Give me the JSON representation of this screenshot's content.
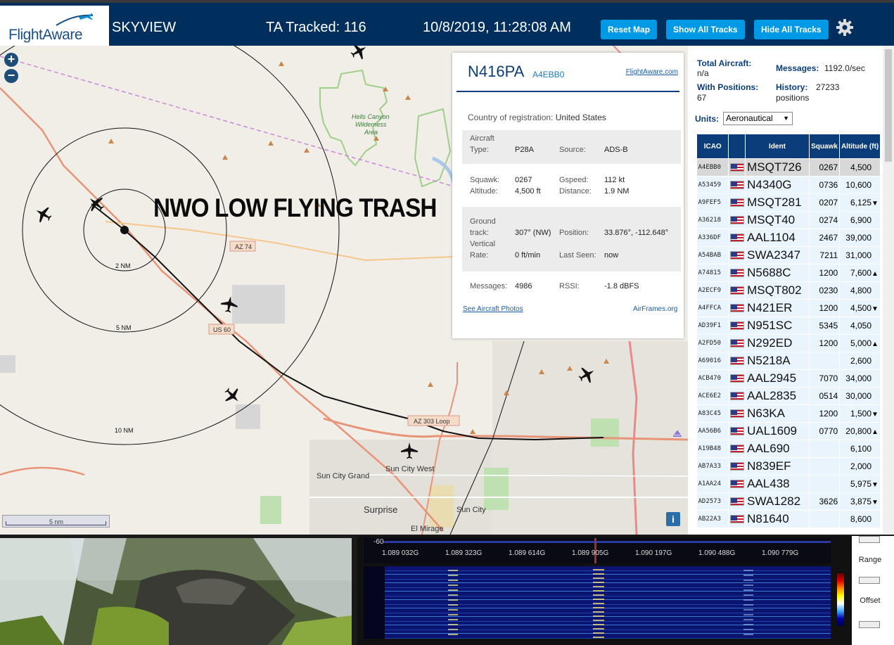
{
  "header": {
    "logo_text": "FlightAware",
    "app_name": "SKYVIEW",
    "tracked": "TA Tracked: 116",
    "datetime": "10/8/2019, 11:28:08 AM",
    "btn_reset": "Reset Map",
    "btn_show": "Show All Tracks",
    "btn_hide": "Hide All Tracks"
  },
  "map": {
    "watermark": "NWO LOW FLYING TRASH",
    "ring_labels": [
      "2 NM",
      "5 NM",
      "10 NM"
    ],
    "place_labels": [
      "Hells Canyon",
      "Wilderness",
      "Area",
      "Sun City West",
      "Sun City Grand",
      "Surprise",
      "Sun City",
      "El Mirage"
    ],
    "road_labels": [
      "AZ 74",
      "US 60",
      "AZ 303 Loop"
    ],
    "scale": "5 nm",
    "info": "i"
  },
  "popup": {
    "ident": "N416PA",
    "hex": "A4EBB0",
    "link": "FlightAware.com",
    "country_label": "Country of registration:",
    "country": "United States",
    "aircraft_type_label_1": "Aircraft",
    "aircraft_type_label_2": "Type:",
    "aircraft_type": "P28A",
    "source_label": "Source:",
    "source": "ADS-B",
    "squawk_label": "Squawk:",
    "squawk": "0267",
    "gspeed_label": "Gspeed:",
    "gspeed": "112 kt",
    "altitude_label": "Altitude:",
    "altitude": "4,500 ft",
    "distance_label": "Distance:",
    "distance": "1.9 NM",
    "ground_label_1": "Ground",
    "ground_label_2": "track:",
    "ground_track": "307° (NW)",
    "position_label": "Position:",
    "position": "33.876°, -112.648°",
    "vertical_label_1": "Vertical",
    "vertical_label_2": "Rate:",
    "vertical_rate": "0 ft/min",
    "last_seen_label": "Last Seen:",
    "last_seen": "now",
    "messages_label": "Messages:",
    "messages": "4986",
    "rssi_label": "RSSI:",
    "rssi": "-1.8 dBFS",
    "photos_link": "See Aircraft Photos",
    "airframes_link": "AirFrames.org"
  },
  "sidebar": {
    "total_label": "Total Aircraft:",
    "total_value": "n/a",
    "messages_label": "Messages:",
    "messages_value": "1192.0/sec",
    "with_pos_label": "With Positions:",
    "with_pos_value": "67",
    "history_label": "History:",
    "history_value": "27233",
    "history_unit": "positions",
    "units_label": "Units:",
    "units_value": "Aeronautical",
    "columns": [
      "ICAO",
      "",
      "Ident",
      "Squawk",
      "Altitude (ft)"
    ],
    "rows": [
      {
        "icao": "A4EBB0",
        "ident": "MSQT726",
        "squawk": "0267",
        "alt": "4,500",
        "trend": ""
      },
      {
        "icao": "A53459",
        "ident": "N4340G",
        "squawk": "0736",
        "alt": "10,600",
        "trend": ""
      },
      {
        "icao": "A9FEF5",
        "ident": "MSQT281",
        "squawk": "0207",
        "alt": "6,125",
        "trend": "▼"
      },
      {
        "icao": "A36218",
        "ident": "MSQT40",
        "squawk": "0274",
        "alt": "6,900",
        "trend": ""
      },
      {
        "icao": "A336DF",
        "ident": "AAL1104",
        "squawk": "2467",
        "alt": "39,000",
        "trend": ""
      },
      {
        "icao": "A54BAB",
        "ident": "SWA2347",
        "squawk": "7211",
        "alt": "31,000",
        "trend": ""
      },
      {
        "icao": "A74815",
        "ident": "N5688C",
        "squawk": "1200",
        "alt": "7,600",
        "trend": "▲"
      },
      {
        "icao": "A2ECF9",
        "ident": "MSQT802",
        "squawk": "0230",
        "alt": "4,800",
        "trend": ""
      },
      {
        "icao": "A4FFCA",
        "ident": "N421ER",
        "squawk": "1200",
        "alt": "4,500",
        "trend": "▼"
      },
      {
        "icao": "AD39F1",
        "ident": "N951SC",
        "squawk": "5345",
        "alt": "4,050",
        "trend": ""
      },
      {
        "icao": "A2FD50",
        "ident": "N292ED",
        "squawk": "1200",
        "alt": "5,000",
        "trend": "▲"
      },
      {
        "icao": "A69016",
        "ident": "N5218A",
        "squawk": "",
        "alt": "2,600",
        "trend": ""
      },
      {
        "icao": "ACB470",
        "ident": "AAL2945",
        "squawk": "7070",
        "alt": "34,000",
        "trend": ""
      },
      {
        "icao": "ACE6E2",
        "ident": "AAL2835",
        "squawk": "0514",
        "alt": "30,000",
        "trend": ""
      },
      {
        "icao": "A83C45",
        "ident": "N63KA",
        "squawk": "1200",
        "alt": "1,500",
        "trend": "▼"
      },
      {
        "icao": "AA56B6",
        "ident": "UAL1609",
        "squawk": "0770",
        "alt": "20,800",
        "trend": "▲"
      },
      {
        "icao": "A19B48",
        "ident": "AAL690",
        "squawk": "",
        "alt": "6,100",
        "trend": ""
      },
      {
        "icao": "AB7A33",
        "ident": "N839EF",
        "squawk": "",
        "alt": "2,000",
        "trend": ""
      },
      {
        "icao": "A1AA24",
        "ident": "AAL438",
        "squawk": "",
        "alt": "5,975",
        "trend": "▼"
      },
      {
        "icao": "AD2573",
        "ident": "SWA1282",
        "squawk": "3626",
        "alt": "3,875",
        "trend": "▼"
      },
      {
        "icao": "AB22A3",
        "ident": "N81640",
        "squawk": "",
        "alt": "8,600",
        "trend": ""
      }
    ]
  },
  "sdr": {
    "db_label": "-60",
    "freqs": [
      "1.089 032G",
      "1.089 323G",
      "1.089 614G",
      "1.089 905G",
      "1.090 197G",
      "1.090 488G",
      "1.090 779G"
    ],
    "range_label": "Range",
    "offset_label": "Offset"
  },
  "colors": {
    "header_bg": "#002f5d",
    "button": "#0099e6",
    "table_header": "#0a3d7a",
    "row_bg": "#e9f4fc"
  }
}
